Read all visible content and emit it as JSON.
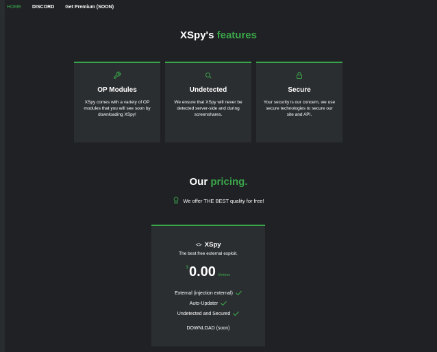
{
  "nav": {
    "home": "HOME",
    "discord": "DISCORD",
    "premium": "Get Premium (SOON)"
  },
  "features_section": {
    "title_main": "XSpy's",
    "title_accent": "features",
    "cards": [
      {
        "icon": "wrench-icon",
        "title": "OP Modules",
        "text": "XSpy comes with a variety of OP modules that you will see soon by downloading XSpy!"
      },
      {
        "icon": "search-icon",
        "title": "Undetected",
        "text": "We ensure that XSpy will never be detected server-side and during screenshares."
      },
      {
        "icon": "lock-icon",
        "title": "Secure",
        "text": "Your security is our concern, we use secure technologies to secure our site and API."
      }
    ]
  },
  "pricing": {
    "title_main": "Our",
    "title_accent": "pricing.",
    "subtitle": "We offer THE BEST quality for free!",
    "plan": {
      "code_symbol": "<>",
      "name": "XSpy",
      "description": "The best free external exploit.",
      "currency": "$",
      "price": "0.00",
      "period": "lifetime",
      "features": [
        "External (injection external)",
        "Auto-Updater",
        "Undetected and Secured"
      ],
      "download_label": "DOWNLOAD (soon)"
    }
  },
  "colors": {
    "background": "#1f2124",
    "card": "#2b2e31",
    "accent": "#3aa64a",
    "text": "#ffffff"
  }
}
